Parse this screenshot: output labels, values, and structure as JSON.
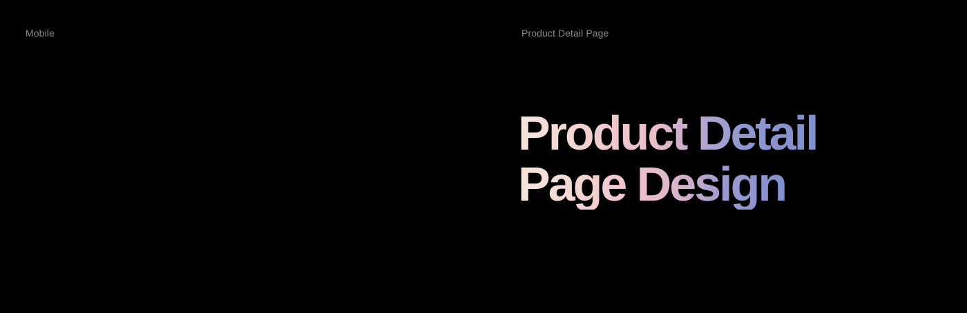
{
  "labels": {
    "left": "Mobile",
    "right": "Product Detail Page"
  },
  "headline": {
    "line1": "Product Detail",
    "line2": "Page Design"
  },
  "colors": {
    "background": "#000000",
    "label_text": "#8a8a8a",
    "gradient_start": "#f6e6dc",
    "gradient_mid": "#ecbdc8",
    "gradient_end": "#7f8ecf"
  }
}
